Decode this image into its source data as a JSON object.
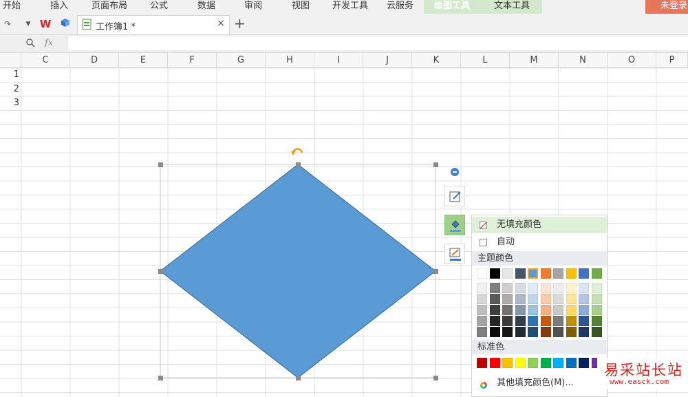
{
  "menu": {
    "items": [
      "开始",
      "插入",
      "页面布局",
      "公式",
      "数据",
      "审阅",
      "视图",
      "开发工具",
      "云服务"
    ],
    "context_tabs": [
      "绘图工具",
      "文本工具"
    ],
    "login": "未登录"
  },
  "tabbar": {
    "doc_title": "工作簿1 *",
    "close": "×",
    "add": "+"
  },
  "formula_bar": {
    "zoom_icon": "magnifier-icon",
    "fx": "fx"
  },
  "grid": {
    "columns": [
      "C",
      "D",
      "E",
      "F",
      "G",
      "H",
      "I",
      "J",
      "K",
      "L",
      "M",
      "N",
      "O",
      "P"
    ],
    "rows": [
      "1",
      "2",
      "3"
    ]
  },
  "shape": {
    "fill": "#5b9bd5",
    "stroke": "#41719c"
  },
  "palette": {
    "no_fill": "无填充颜色",
    "auto": "自动",
    "theme_title": "主题颜色",
    "standard_title": "标准色",
    "more_colors": "其他填充颜色(M)...",
    "theme_top": [
      "#ffffff",
      "#000000",
      "#e7e6e6",
      "#44546a",
      "#5b9bd5",
      "#ed7d31",
      "#a5a5a5",
      "#ffc000",
      "#4472c4",
      "#70ad47"
    ],
    "theme_shades": [
      [
        "#f2f2f2",
        "#7f7f7f",
        "#d0cece",
        "#d6dce4",
        "#deebf6",
        "#fbe5d5",
        "#ededed",
        "#fff2cc",
        "#dae3f3",
        "#e2efd9"
      ],
      [
        "#d8d8d8",
        "#595959",
        "#aeaaaa",
        "#adb9ca",
        "#bdd7ee",
        "#f7cbac",
        "#dbdbdb",
        "#fee599",
        "#b4c6e7",
        "#c5e0b3"
      ],
      [
        "#bfbfbf",
        "#3f3f3f",
        "#757070",
        "#8496b0",
        "#9cc3e5",
        "#f4b183",
        "#c9c9c9",
        "#ffd965",
        "#8eaadb",
        "#a8d08d"
      ],
      [
        "#a5a5a5",
        "#262626",
        "#3a3838",
        "#323f4f",
        "#2e75b5",
        "#c55a11",
        "#7b7b7b",
        "#bf9000",
        "#2f5496",
        "#538135"
      ],
      [
        "#7f7f7f",
        "#0c0c0c",
        "#171616",
        "#222a35",
        "#1e4e79",
        "#833c0b",
        "#525252",
        "#7f6000",
        "#1f3864",
        "#375623"
      ]
    ],
    "standard": [
      "#c00000",
      "#ff0000",
      "#ffc000",
      "#ffff00",
      "#92d050",
      "#00b050",
      "#00b0f0",
      "#0070c0",
      "#002060",
      "#7030a0"
    ]
  },
  "watermark": {
    "text": "易采站长站",
    "url": "www.easck.com"
  }
}
